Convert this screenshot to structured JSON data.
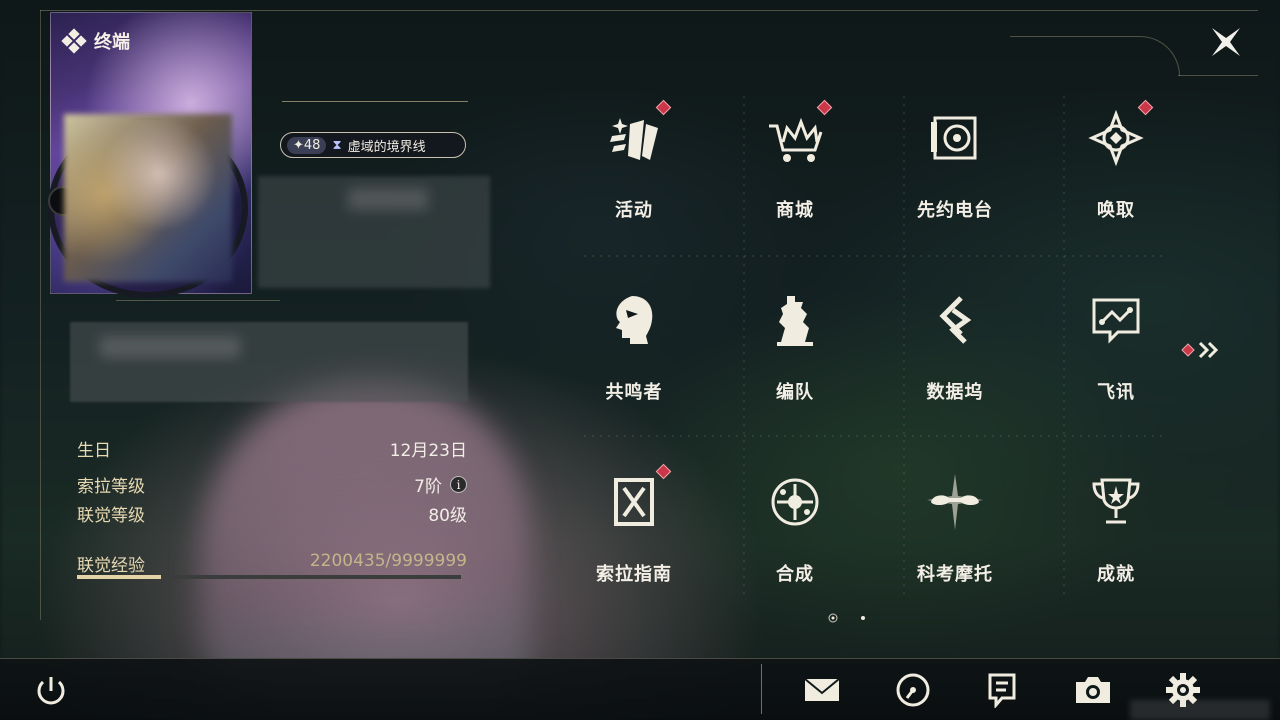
{
  "header": {
    "title": "终端"
  },
  "profile": {
    "level": "48",
    "badge_name": "虚域的境界线"
  },
  "info": {
    "birthday_label": "生日",
    "birthday_value": "12月23日",
    "sola_level_label": "索拉等级",
    "sola_level_value": "7阶",
    "sola_info_icon": "i",
    "union_level_label": "联觉等级",
    "union_level_value": "80级",
    "union_exp_label": "联觉经验",
    "union_exp_value": "2200435/9999999",
    "union_exp_fraction": 0.22
  },
  "menu": {
    "items": [
      {
        "label": "活动",
        "icon": "event-icon",
        "badge": true
      },
      {
        "label": "商城",
        "icon": "shop-icon",
        "badge": true
      },
      {
        "label": "先约电台",
        "icon": "radio-icon",
        "badge": false
      },
      {
        "label": "唤取",
        "icon": "convene-icon",
        "badge": true
      },
      {
        "label": "共鸣者",
        "icon": "resonator-icon",
        "badge": false
      },
      {
        "label": "编队",
        "icon": "team-icon",
        "badge": false
      },
      {
        "label": "数据坞",
        "icon": "data-bank-icon",
        "badge": false
      },
      {
        "label": "飞讯",
        "icon": "message-icon",
        "badge": false
      },
      {
        "label": "索拉指南",
        "icon": "guide-icon",
        "badge": true
      },
      {
        "label": "合成",
        "icon": "synthesis-icon",
        "badge": false
      },
      {
        "label": "科考摩托",
        "icon": "motorcycle-icon",
        "badge": false
      },
      {
        "label": "成就",
        "icon": "trophy-icon",
        "badge": false
      }
    ],
    "page_count": 2,
    "current_page": 1
  },
  "bottom_bar": {
    "icons": [
      "mail-icon",
      "clock-icon",
      "notice-icon",
      "camera-icon",
      "settings-icon"
    ]
  },
  "colors": {
    "badge_red": "#c93748",
    "accent_gold": "#e3d3a6",
    "text_gold": "#e7d9b2"
  }
}
